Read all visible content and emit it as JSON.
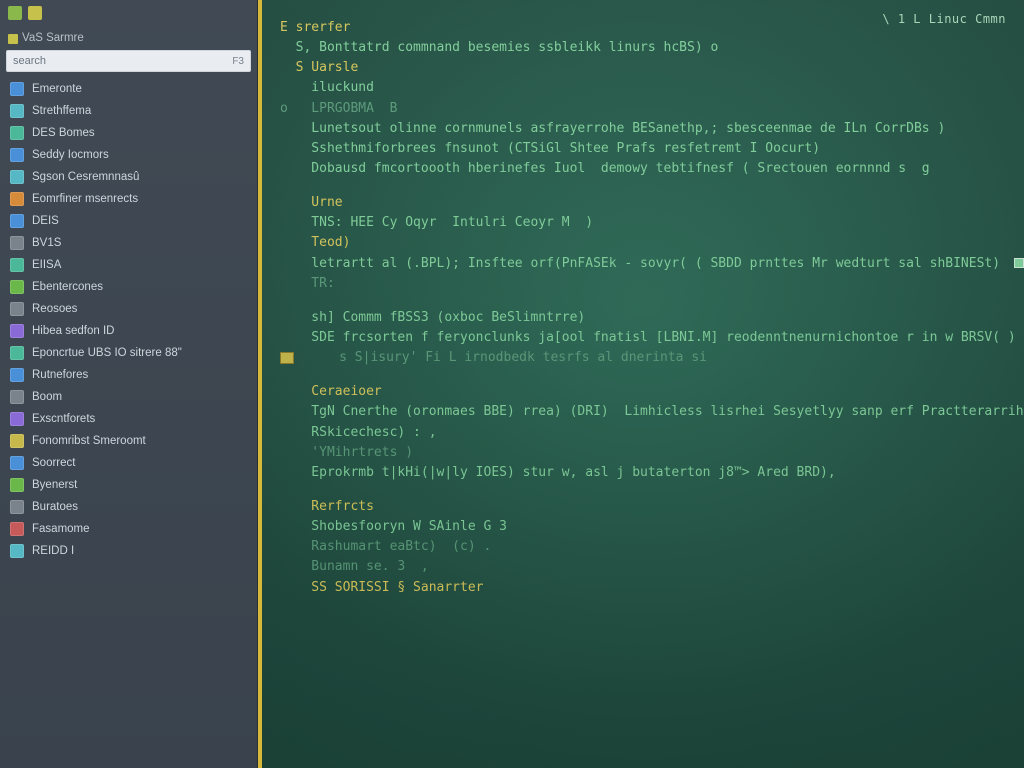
{
  "sidebar": {
    "top_hint": "",
    "section_title": "VaS Sarmre",
    "search": {
      "value": "search",
      "kbd": "F3"
    },
    "items": [
      {
        "label": "Emeronte",
        "color": "c-blue"
      },
      {
        "label": "Strethffema",
        "color": "c-cyan"
      },
      {
        "label": "DES Bomes",
        "color": "c-teal"
      },
      {
        "label": "Seddy Iocmors",
        "color": "c-blue"
      },
      {
        "label": "Sgson Cesremnnasû",
        "color": "c-cyan"
      },
      {
        "label": "Eomrfiner msenrects",
        "color": "c-orange"
      },
      {
        "label": "DEIS",
        "color": "c-blue"
      },
      {
        "label": "BV1S",
        "color": "c-grey"
      },
      {
        "label": "EIISA",
        "color": "c-teal"
      },
      {
        "label": "Ebentercones",
        "color": "c-green"
      },
      {
        "label": "Reosoes",
        "color": "c-grey"
      },
      {
        "label": "Hibea sedfon ID",
        "color": "c-purple"
      },
      {
        "label": "Eponcrtue UBS IO sitrere 88\"",
        "color": "c-teal"
      },
      {
        "label": "Rutnefores",
        "color": "c-blue"
      },
      {
        "label": "Boom",
        "color": "c-grey"
      },
      {
        "label": "Exscntforets",
        "color": "c-purple"
      },
      {
        "label": "Fonomribst Smeroomt",
        "color": "c-yellow"
      },
      {
        "label": "Soorrect",
        "color": "c-blue"
      },
      {
        "label": "Byenerst",
        "color": "c-green"
      },
      {
        "label": "Buratoes",
        "color": "c-grey"
      },
      {
        "label": "Fasamome",
        "color": "c-red"
      },
      {
        "label": "REIDD I",
        "color": "c-cyan"
      }
    ]
  },
  "terminal": {
    "status": "\\ 1   L Linuc Cmmn",
    "blocks": [
      {
        "lines": [
          {
            "cls": "hl-y",
            "text": "E srerfer"
          },
          {
            "cls": "",
            "text": "  S, Bonttatrd commnand besemies ssbleikk linurs hcBS) o"
          },
          {
            "cls": "hl-y",
            "text": "  S Uarsle"
          },
          {
            "cls": "",
            "text": "    iluckund"
          },
          {
            "cls": "hl-d",
            "text": "o   LPRGOBMA  B"
          },
          {
            "cls": "",
            "text": "    Lunetsout olinne cornmunels asfrayerrohe BESanethp,; sbesceenmae de ILn CorrDBs )"
          },
          {
            "cls": "",
            "text": "    Sshethmiforbrees fnsunot (CTSiGl Shtee Prafs resfetremt I Oocurt)"
          },
          {
            "cls": "",
            "text": "    Dobausd fmcortoooth hberinefes Iuol  demowy tebtifnesf ( Srectouen eornnnd s  g"
          }
        ]
      },
      {
        "lines": [
          {
            "cls": "hl-y",
            "text": "    Urne"
          },
          {
            "cls": "",
            "text": "    TNS: HEE Cy Oqyr  Intulri Ceoyr M  )"
          },
          {
            "cls": "hl-y",
            "text": "    Teod)"
          },
          {
            "cls": "",
            "text": "    letrartt al (.BPL); Insftee orf(PnFASEk - sovyr( ( SBDD prnttes Mr wedturt sal shBINESt) ▫"
          },
          {
            "cls": "hl-d",
            "text": "    TR:"
          }
        ]
      },
      {
        "lines": [
          {
            "cls": "",
            "text": "    sh] Commm fBSS3 (oxboc BeSlimntrre)"
          },
          {
            "cls": "",
            "text": "    SDE frcsorten f feryonclunks ja[ool fnatisl [LBNI.M] reodenntnenurnichontoe r in w BRSV( ) "
          },
          {
            "cls": "hl-d",
            "text": "◘     s S|isury' Fi L irnodbedk tesrfs al dnerinta si"
          }
        ]
      },
      {
        "lines": [
          {
            "cls": "hl-y",
            "text": "    Ceraeioer"
          },
          {
            "cls": "",
            "text": "    TgN Cnerthe (oronmaes BBE) rrea) (DRI)  Limhicless lisrhei Sesyetlyy sanp erf Practterarriht e"
          },
          {
            "cls": "",
            "text": "    RSkicechesc) : ,"
          },
          {
            "cls": "hl-d",
            "text": "    'YMihrtrets )"
          },
          {
            "cls": "",
            "text": "    Eprokrmb t|kHi(|w|ly IOES) stur w, asl j butaterton j8™> Ared BRD),"
          }
        ]
      },
      {
        "lines": [
          {
            "cls": "hl-y",
            "text": "    Rerfrcts"
          },
          {
            "cls": "",
            "text": "    Shobesfooryn W SAinle G 3"
          },
          {
            "cls": "hl-d",
            "text": "    Rashumart eaBtc)  (c) ."
          },
          {
            "cls": "hl-d",
            "text": "    Bunamn se. 3  ,"
          },
          {
            "cls": "hl-y",
            "text": "    SS SORISSI § Sanarrter"
          }
        ]
      }
    ]
  }
}
